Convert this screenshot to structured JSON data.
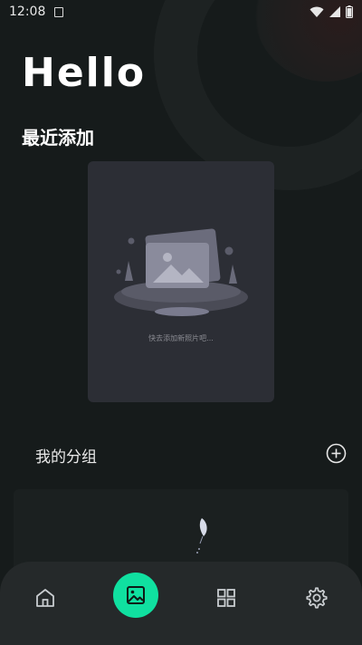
{
  "status_bar": {
    "time": "12:08",
    "icons": [
      "notification-icon",
      "wifi-icon",
      "signal-icon",
      "battery-icon"
    ]
  },
  "header": {
    "greeting": "Hello"
  },
  "recent": {
    "title": "最近添加",
    "empty_text": "快去添加新照片吧..."
  },
  "groups": {
    "title": "我的分组",
    "add_icon": "plus-circle-icon"
  },
  "tabbar": {
    "items": [
      {
        "icon": "home-icon",
        "active": false
      },
      {
        "icon": "gallery-icon",
        "active": true
      },
      {
        "icon": "grid-icon",
        "active": false
      },
      {
        "icon": "gear-icon",
        "active": false
      }
    ]
  },
  "colors": {
    "background": "#161b1b",
    "accent": "#10e0a0",
    "card": "#2c2e35",
    "tabbar": "#25292a"
  }
}
